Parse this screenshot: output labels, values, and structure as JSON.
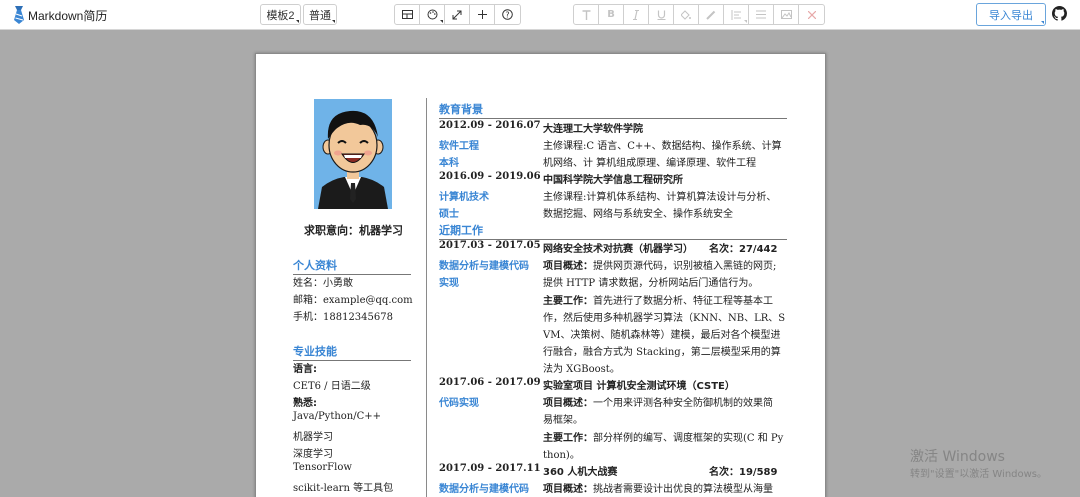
{
  "app": {
    "title": "Markdown简历"
  },
  "toolbar": {
    "template_label": "模板2",
    "style_label": "普通",
    "export_label": "导入导出",
    "view_icons": [
      "layout-icon",
      "palette-icon",
      "fullscreen-icon",
      "plus-icon",
      "help-icon"
    ],
    "format_icons": [
      "text-icon",
      "bold-icon",
      "italic-icon",
      "underline-icon",
      "fill-icon",
      "pen-icon",
      "align-icon",
      "list-icon",
      "image-icon",
      "close-icon"
    ]
  },
  "resume": {
    "intent": "求职意向：机器学习",
    "personal": {
      "heading": "个人资料",
      "lines": [
        "姓名：小勇敢",
        "邮箱：example@qq.com",
        "手机：18812345678"
      ]
    },
    "skills": {
      "heading": "专业技能",
      "lines": [
        {
          "text": "语言:",
          "bold": true
        },
        {
          "text": "CET6 / 日语二级",
          "bold": false
        },
        {
          "text": "熟悉:",
          "bold": true
        },
        {
          "text": "Java/Python/C++",
          "bold": false
        },
        {
          "text": "机器学习",
          "bold": false
        },
        {
          "text": "深度学习",
          "bold": false
        },
        {
          "text": "TensorFlow",
          "bold": false
        },
        {
          "text": "scikit-learn 等工具包",
          "bold": false
        }
      ]
    },
    "education": {
      "heading": "教育背景",
      "entries": [
        {
          "date": "2012.09 - 2016.07",
          "school": "大连理工大学软件学院",
          "major": "软件工程",
          "degree": "本科",
          "lines": [
            "主修课程:C 语言、C++、数据结构、操作系统、计算",
            "机网络、计 算机组成原理、编译原理、软件工程"
          ]
        },
        {
          "date": "2016.09 - 2019.06",
          "school": "中国科学院大学信息工程研究所",
          "major": "计算机技术",
          "degree": "硕士",
          "lines": [
            "主修课程:计算机体系结构、计算机算法设计与分析、",
            "数据挖掘、网络与系统安全、操作系统安全"
          ]
        }
      ]
    },
    "work": {
      "heading": "近期工作",
      "entries": [
        {
          "date": "2017.03 - 2017.05",
          "title": "网络安全技术对抗赛（机器学习）",
          "rank": "名次：27/442",
          "tag": [
            "数据分析与建模代码",
            "实现"
          ],
          "lines": [
            {
              "k": "项目概述：",
              "t": "提供网页源代码，识别被植入黑链的网页;"
            },
            {
              "k": "",
              "t": "提供 HTTP 请求数据，分析网站后门通信行为。"
            },
            {
              "k": "主要工作：",
              "t": "首先进行了数据分析、特征工程等基本工"
            },
            {
              "k": "",
              "t": "作，然后使用多种机器学习算法（KNN、NB、LR、S"
            },
            {
              "k": "",
              "t": "VM、决策树、随机森林等）建模，最后对各个模型进"
            },
            {
              "k": "",
              "t": "行融合，融合方式为 Stacking，第二层模型采用的算"
            },
            {
              "k": "",
              "t": "法为 XGBoost。"
            }
          ]
        },
        {
          "date": "2017.06 - 2017.09",
          "title": "实验室项目 计算机安全测试环境（CSTE）",
          "rank": "",
          "tag": [
            "代码实现"
          ],
          "lines": [
            {
              "k": "项目概述：",
              "t": "一个用来评测各种安全防御机制的效果简"
            },
            {
              "k": "",
              "t": "易框架。"
            },
            {
              "k": "主要工作：",
              "t": "部分样例的编写、调度框架的实现(C 和 Py"
            },
            {
              "k": "",
              "t": "thon)。"
            }
          ]
        },
        {
          "date": "2017.09 - 2017.11",
          "title": "360 人机大战赛",
          "rank": "名次：19/589",
          "tag": [
            "数据分析与建模代码"
          ],
          "lines": [
            {
              "k": "项目概述：",
              "t": "挑战者需要设计出优良的算法模型从海量"
            }
          ]
        }
      ]
    }
  },
  "watermark": {
    "line1": "激活 Windows",
    "line2": "转到\"设置\"以激活 Windows。"
  },
  "colors": {
    "accent": "#3a86d4",
    "background": "#aaaaaa",
    "avatar_bg": "#6fb3e8"
  }
}
